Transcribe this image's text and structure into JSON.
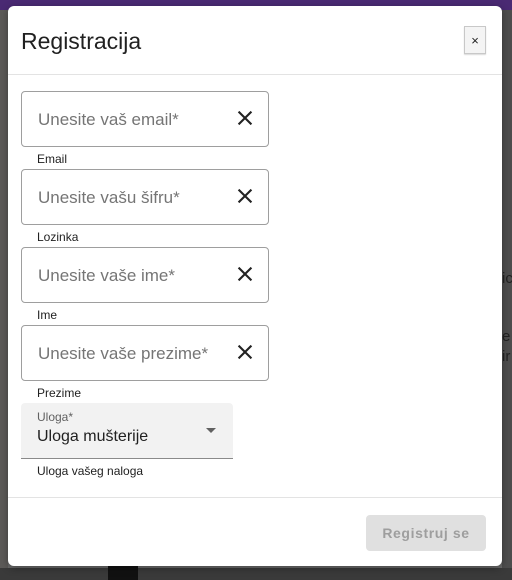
{
  "dialog": {
    "title": "Registracija",
    "close_label": "×"
  },
  "fields": [
    {
      "placeholder": "Unesite vaš email*",
      "caption": "Email"
    },
    {
      "placeholder": "Unesite vašu šifru*",
      "caption": "Lozinka"
    },
    {
      "placeholder": "Unesite vaše ime*",
      "caption": "Ime"
    },
    {
      "placeholder": "Unesite vaše prezime*",
      "caption": "Prezime"
    }
  ],
  "role": {
    "label": "Uloga*",
    "value": "Uloga mušterije",
    "caption": "Uloga vašeg naloga"
  },
  "footer": {
    "submit_label": "Registruj se"
  },
  "background": {
    "fragments": [
      "ic",
      "e",
      "ir"
    ]
  },
  "colors": {
    "topbar": "#4a2a73",
    "dialog_bg": "#ffffff",
    "disabled_button_bg": "#e0e0e0",
    "disabled_button_text": "#9e9e9e"
  },
  "icons": {
    "clear": "close-x-icon",
    "dropdown": "caret-down-icon"
  }
}
